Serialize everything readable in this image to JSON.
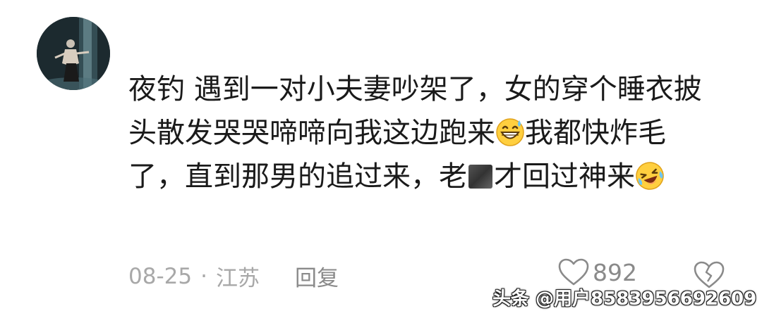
{
  "comment": {
    "username": "",
    "text_part1": "夜钓 遇到一对小夫妻吵架了，女的穿个睡衣披头散发哭哭啼啼向我这边跑来",
    "text_part2": "我都快炸毛了，直到那男的追过来，老",
    "text_part3": "才回过神来",
    "emoji1": "grin-sweat-icon",
    "emoji2": "laughing-tears-icon"
  },
  "meta": {
    "date": "08-25",
    "separator": "·",
    "location": "江苏",
    "reply_label": "回复"
  },
  "actions": {
    "like_count": "892"
  },
  "watermark": {
    "text": "头条 @用户8583956692609"
  }
}
